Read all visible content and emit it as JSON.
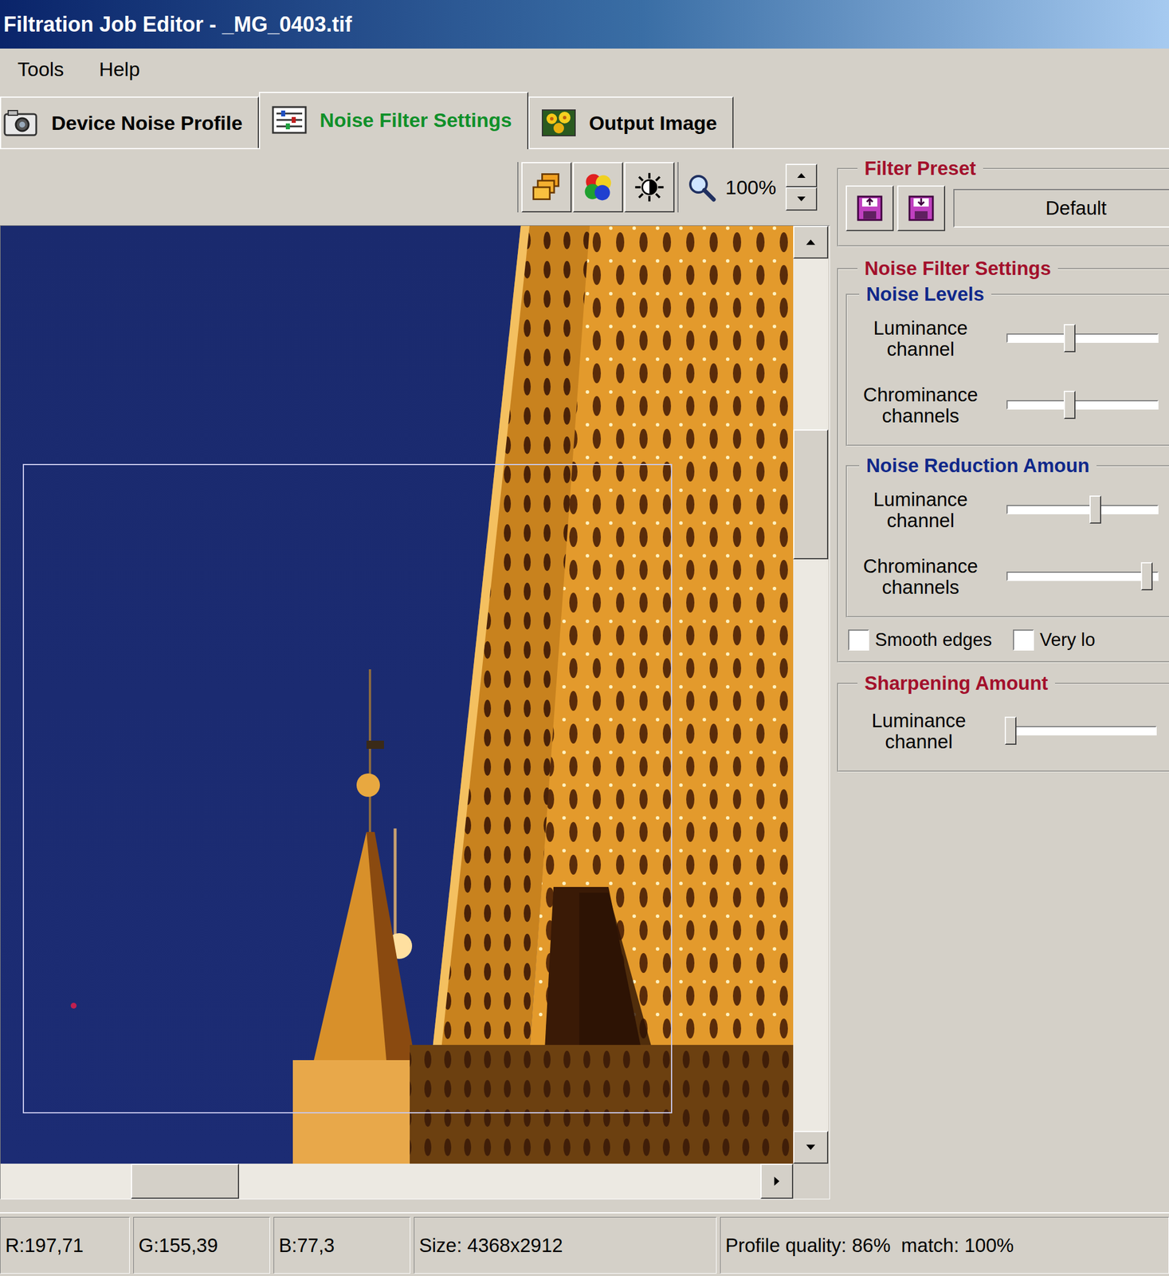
{
  "window": {
    "title": "Filtration Job Editor - _MG_0403.tif"
  },
  "menu": [
    "Tools",
    "Help"
  ],
  "tabs": [
    {
      "label": "Device Noise Profile",
      "selected": false
    },
    {
      "label": "Noise Filter Settings",
      "selected": true
    },
    {
      "label": "Output Image",
      "selected": false
    }
  ],
  "toolbar": {
    "zoom": "100%"
  },
  "viewer": {
    "vertical_scroll": {
      "level": 0.23
    },
    "horizontal_scroll": {
      "level": 0.2
    }
  },
  "filter_preset": {
    "title": "Filter Preset",
    "value": "Default"
  },
  "noise_filter": {
    "title": "Noise Filter Settings",
    "groups": [
      {
        "title": "Noise Levels",
        "sliders": [
          {
            "label": "Luminance channel",
            "level": 0.41
          },
          {
            "label": "Chrominance channels",
            "level": 0.41
          }
        ]
      },
      {
        "title": "Noise Reduction Amoun",
        "sliders": [
          {
            "label": "Luminance channel",
            "level": 0.59
          },
          {
            "label": "Chrominance channels",
            "level": 0.96
          }
        ]
      }
    ],
    "checkboxes": [
      {
        "label": "Smooth edges",
        "checked": false
      },
      {
        "label": "Very lo",
        "checked": false
      }
    ]
  },
  "sharpening": {
    "title": "Sharpening Amount",
    "sliders": [
      {
        "label": "Luminance channel",
        "level": 0.0
      }
    ]
  },
  "status_bar": [
    "R:197,71",
    "G:155,39",
    "B:77,3",
    "Size: 4368x2912",
    "Profile quality: 86%  match: 100%"
  ]
}
